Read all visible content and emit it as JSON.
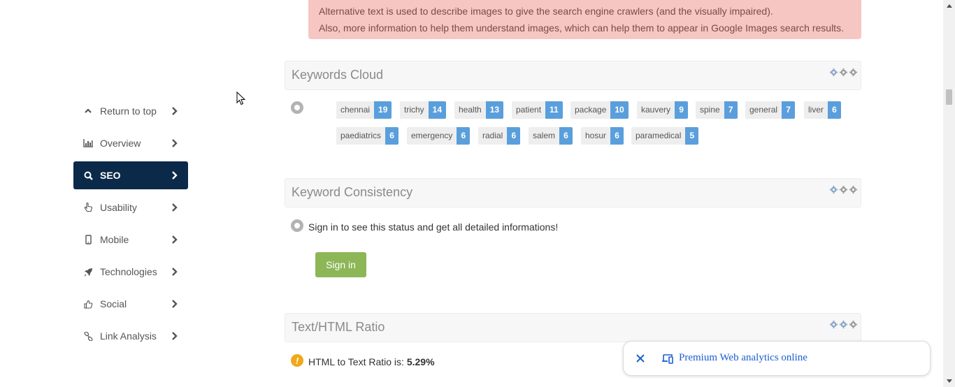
{
  "alert": {
    "line1": "Alternative text is used to describe images to give the search engine crawlers (and the visually impaired).",
    "line2": "Also, more information to help them understand images, which can help them to appear in Google Images search results."
  },
  "sidebar": {
    "items": [
      {
        "label": "Return to top",
        "icon": "chevron-up-icon"
      },
      {
        "label": "Overview",
        "icon": "bar-chart-icon"
      },
      {
        "label": "SEO",
        "icon": "search-icon",
        "active": true
      },
      {
        "label": "Usability",
        "icon": "pointer-hand-icon"
      },
      {
        "label": "Mobile",
        "icon": "mobile-icon"
      },
      {
        "label": "Technologies",
        "icon": "rocket-icon"
      },
      {
        "label": "Social",
        "icon": "thumbs-up-icon"
      },
      {
        "label": "Link Analysis",
        "icon": "link-icon"
      }
    ]
  },
  "keywords_cloud": {
    "title": "Keywords Cloud",
    "tags": [
      {
        "keyword": "chennai",
        "count": "19"
      },
      {
        "keyword": "trichy",
        "count": "14"
      },
      {
        "keyword": "health",
        "count": "13"
      },
      {
        "keyword": "patient",
        "count": "11"
      },
      {
        "keyword": "package",
        "count": "10"
      },
      {
        "keyword": "kauvery",
        "count": "9"
      },
      {
        "keyword": "spine",
        "count": "7"
      },
      {
        "keyword": "general",
        "count": "7"
      },
      {
        "keyword": "liver",
        "count": "6"
      },
      {
        "keyword": "paediatrics",
        "count": "6"
      },
      {
        "keyword": "emergency",
        "count": "6"
      },
      {
        "keyword": "radial",
        "count": "6"
      },
      {
        "keyword": "salem",
        "count": "6"
      },
      {
        "keyword": "hosur",
        "count": "6"
      },
      {
        "keyword": "paramedical",
        "count": "5"
      }
    ]
  },
  "keyword_consistency": {
    "title": "Keyword Consistency",
    "message": "Sign in to see this status and get all detailed informations!",
    "signin_label": "Sign in"
  },
  "text_html_ratio": {
    "title": "Text/HTML Ratio",
    "label": "HTML to Text Ratio is: ",
    "value": "5.29%"
  },
  "ad": {
    "text": "Premium Web analytics online"
  },
  "colors": {
    "nav_active": "#0b2a4a",
    "tag_count": "#5a9fdc",
    "signin": "#8db657",
    "alert_bg": "#f6c6c3",
    "warning": "#f0a81c"
  }
}
